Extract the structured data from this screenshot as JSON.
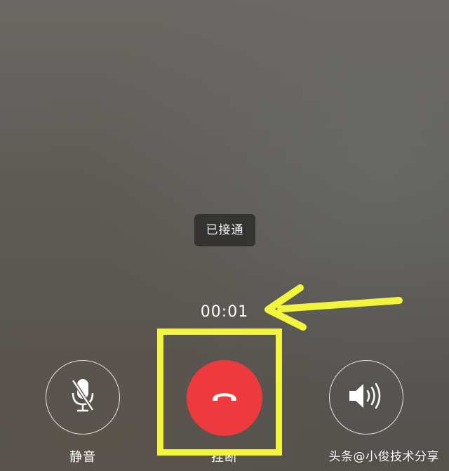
{
  "call": {
    "toast_text": "已接通",
    "timer": "00:01"
  },
  "controls": {
    "mute": {
      "label": "静音",
      "icon": "microphone-muted-icon"
    },
    "hangup": {
      "label": "挂断",
      "icon": "phone-hangup-icon",
      "color": "#ee3a3c"
    },
    "speaker": {
      "label": "",
      "icon": "speaker-icon"
    }
  },
  "annotation": {
    "highlight_color": "#f3f53c"
  },
  "watermark": "头条@小俊技术分享"
}
